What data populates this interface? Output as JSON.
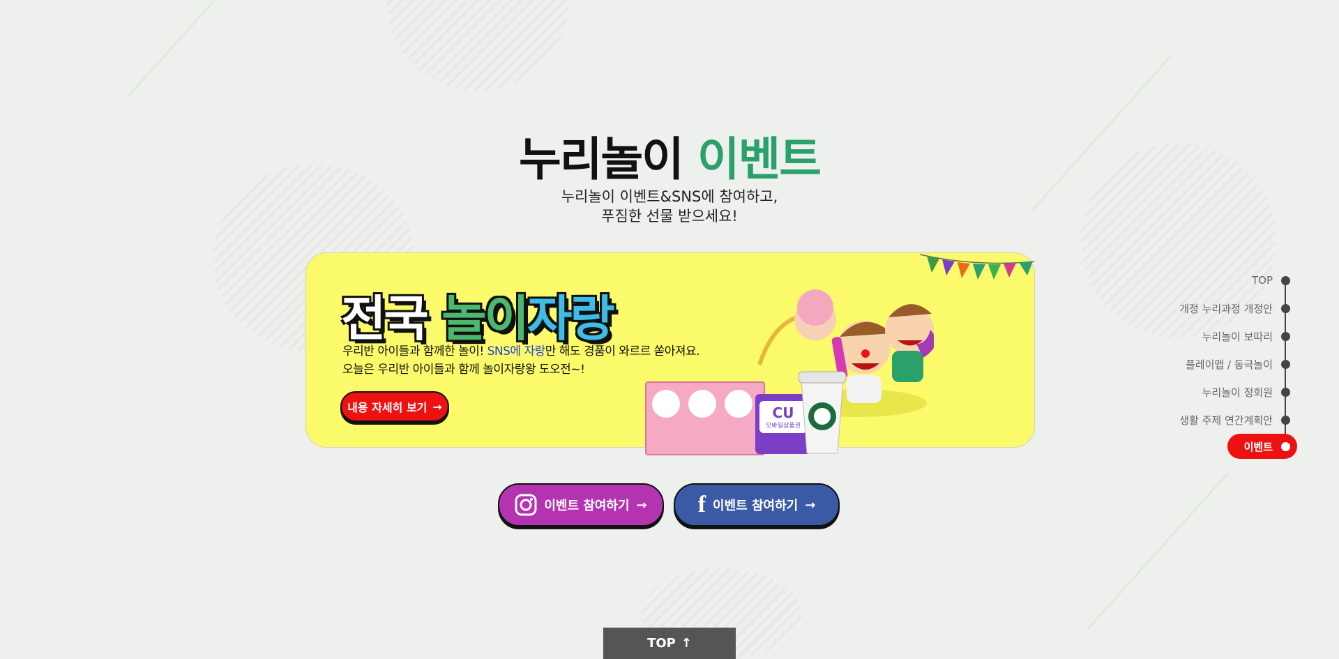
{
  "section": {
    "title_main": "누리놀이",
    "title_accent": "이벤트",
    "subtitle_line1": "누리놀이 이벤트&SNS에 참여하고,",
    "subtitle_line2": "푸짐한 선물 받으세요!"
  },
  "banner": {
    "title_part1": "전국",
    "title_part2": "놀이",
    "title_part3": "자랑",
    "desc_line1_a": "우리반 아이들과 함께한 놀이!",
    "desc_line1_hl": "SNS에 자랑",
    "desc_line1_b": "만 해도 경품이 와르르 쏟아져요.",
    "desc_line2": "오늘은 우리반 아이들과 함께 놀이자랑왕 도오전~!",
    "detail_button": "내용 자세히 보기",
    "cu_label": "CU",
    "voucher_label": "모바일상품권"
  },
  "social": {
    "instagram_button": "이벤트 참여하기",
    "facebook_button": "이벤트 참여하기"
  },
  "side_nav": {
    "items": [
      {
        "label": "TOP"
      },
      {
        "label": "개정 누리과정 개정안"
      },
      {
        "label": "누리놀이 보따리"
      },
      {
        "label": "플레이맵 / 동극놀이"
      },
      {
        "label": "누리놀이 정회원"
      },
      {
        "label": "생활 주제 연간계획안"
      },
      {
        "label": "이벤트"
      }
    ]
  },
  "footer": {
    "top_button": "TOP"
  },
  "colors": {
    "accent_green": "#2aa06a",
    "banner_yellow": "#fbfa6b",
    "red": "#ee1111",
    "instagram": "#b433b1",
    "facebook": "#3b5aa6"
  }
}
